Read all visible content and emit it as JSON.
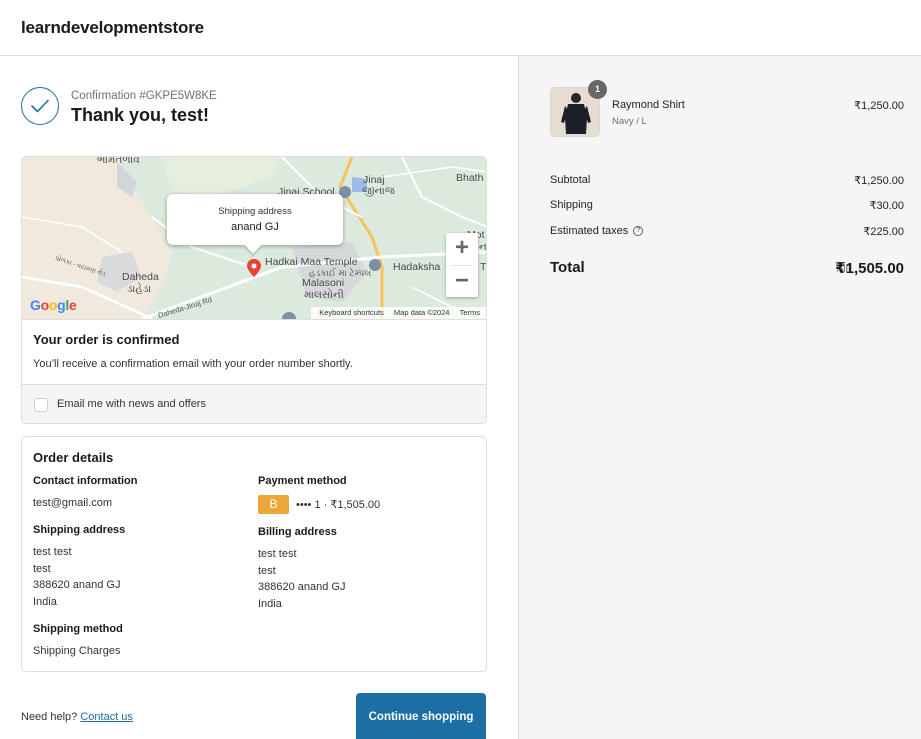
{
  "header": {
    "store_name": "learndevelopmentstore"
  },
  "confirmation": {
    "number": "Confirmation #GKPE5W8KE",
    "title": "Thank you, test!"
  },
  "map": {
    "popup_title": "Shipping address",
    "popup_value": "anand GJ",
    "labels": {
      "bhamtalav": "ભામતળાવ",
      "jinaj_school": "Jinaj School",
      "jinaj_en": "Jinaj",
      "jinaj_gu": "જીનાજ",
      "bhath": "Bhath",
      "hadkai_temple": "Hadkai Maa Temple",
      "hadkai_temple_gu": "હડકાઈ મા ટેમ્પલ",
      "hadaksha": "Hadaksha",
      "mot": "Mot",
      "daheda_en": "Daheda",
      "daheda_gu": "ડાહેડા",
      "malasoni_en": "Malasoni",
      "malasoni_gu": "માલસોની",
      "daheda_jinaj_rd": "Daheda-Jinaj Rd",
      "left_road": "ધોળકા - વટામણ રોડ",
      "t_edge": "T",
      "na_edge": "ના"
    },
    "google": "Google",
    "attribution": {
      "shortcuts": "Keyboard shortcuts",
      "map_data": "Map data ©2024",
      "terms": "Terms"
    },
    "zoom_in": "+",
    "zoom_out": "−"
  },
  "order_status": {
    "title": "Your order is confirmed",
    "text": "You’ll receive a confirmation email with your order number shortly."
  },
  "newsletter": {
    "label": "Email me with news and offers",
    "checked": false
  },
  "order_details": {
    "title": "Order details",
    "contact": {
      "title": "Contact information",
      "email": "test@gmail.com"
    },
    "payment": {
      "title": "Payment method",
      "badge": "B",
      "text": "•••• 1 · ₹1,505.00"
    },
    "shipping_address": {
      "title": "Shipping address",
      "lines": [
        "test test",
        "test",
        "388620 anand GJ",
        "India"
      ]
    },
    "billing_address": {
      "title": "Billing address",
      "lines": [
        "test test",
        "test",
        "388620 anand GJ",
        "India"
      ]
    },
    "shipping_method": {
      "title": "Shipping method",
      "value": "Shipping Charges"
    }
  },
  "footer": {
    "help_text": "Need help?",
    "contact_link": "Contact us",
    "continue_button": "Continue shopping"
  },
  "summary": {
    "product": {
      "name": "Raymond Shirt",
      "variant": "Navy / L",
      "price": "₹1,250.00",
      "quantity": "1"
    },
    "subtotal_label": "Subtotal",
    "subtotal_value": "₹1,250.00",
    "shipping_label": "Shipping",
    "shipping_value": "₹30.00",
    "taxes_label": "Estimated taxes",
    "taxes_info_icon": "?",
    "taxes_value": "₹225.00",
    "total_label": "Total",
    "total_currency": "INR",
    "total_value": "₹1,505.00"
  },
  "colors": {
    "accent": "#1c6ea4",
    "check": "#1f6e96",
    "payment_badge": "#e9a838",
    "summary_bg": "#f5f5f5"
  }
}
